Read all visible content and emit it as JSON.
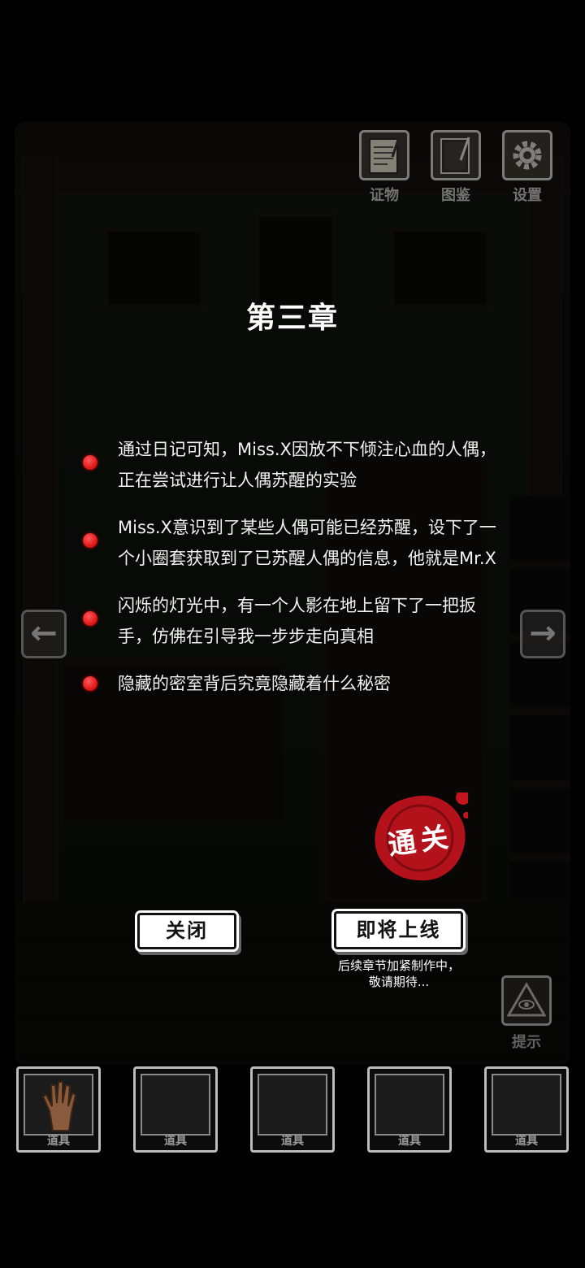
{
  "hud": {
    "evidence_label": "证物",
    "gallery_label": "图鉴",
    "settings_label": "设置"
  },
  "chapter": {
    "title": "第三章",
    "clues": [
      "通过日记可知，Miss.X因放不下倾注心血的人偶，正在尝试进行让人偶苏醒的实验",
      "Miss.X意识到了某些人偶可能已经苏醒，设下了一个小圈套获取到了已苏醒人偶的信息，他就是Mr.X",
      "闪烁的灯光中，有一个人影在地上留下了一把扳手，仿佛在引导我一步步走向真相",
      "隐藏的密室背后究竟隐藏着什么秘密"
    ],
    "seal_text": "通关",
    "close_button": "关闭",
    "coming_soon_button": "即将上线",
    "coming_soon_note_line1": "后续章节加紧制作中，",
    "coming_soon_note_line2": "敬请期待..."
  },
  "nav": {
    "left_arrow": "←",
    "right_arrow": "→"
  },
  "hint_label": "提示",
  "inventory": {
    "slots": [
      {
        "label": "道具",
        "item": "hand-icon"
      },
      {
        "label": "道具",
        "item": ""
      },
      {
        "label": "道具",
        "item": ""
      },
      {
        "label": "道具",
        "item": ""
      },
      {
        "label": "道具",
        "item": ""
      }
    ]
  },
  "colors": {
    "bullet_red": "#e01818",
    "seal_red": "#b3121b",
    "button_bg": "#ffffff",
    "overlay": "rgba(0,0,0,0.68)"
  }
}
